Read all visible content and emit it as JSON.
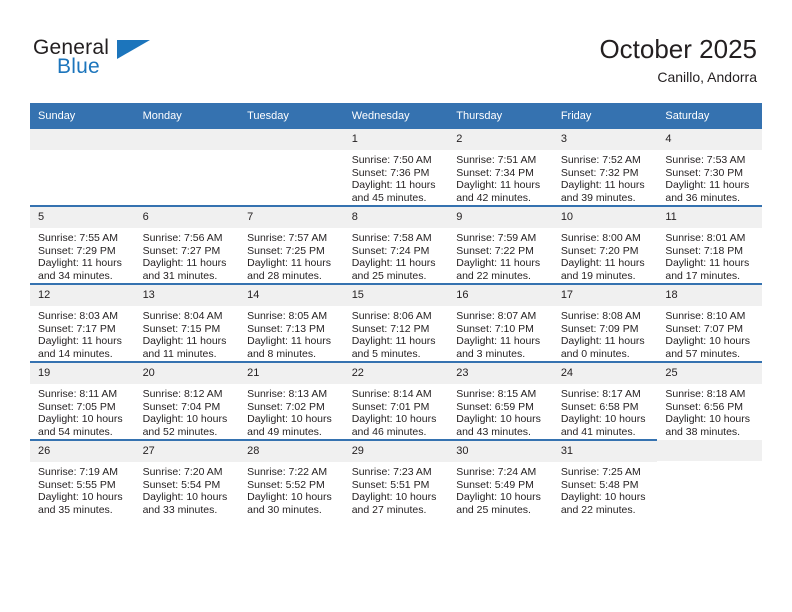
{
  "logo": {
    "word1": "General",
    "word2": "Blue",
    "triangle_color": "#1c75bc",
    "icon": "general-blue-logo"
  },
  "header": {
    "title": "October 2025",
    "location": "Canillo, Andorra",
    "header_bg": "#3572b0"
  },
  "weekdays": [
    "Sunday",
    "Monday",
    "Tuesday",
    "Wednesday",
    "Thursday",
    "Friday",
    "Saturday"
  ],
  "labels": {
    "sunrise": "Sunrise:",
    "sunset": "Sunset:",
    "daylight": "Daylight:"
  },
  "weeks": [
    [
      {
        "day": "",
        "empty": true
      },
      {
        "day": "",
        "empty": true
      },
      {
        "day": "",
        "empty": true
      },
      {
        "day": "1",
        "sunrise": "Sunrise: 7:50 AM",
        "sunset": "Sunset: 7:36 PM",
        "daylight": "Daylight: 11 hours and 45 minutes."
      },
      {
        "day": "2",
        "sunrise": "Sunrise: 7:51 AM",
        "sunset": "Sunset: 7:34 PM",
        "daylight": "Daylight: 11 hours and 42 minutes."
      },
      {
        "day": "3",
        "sunrise": "Sunrise: 7:52 AM",
        "sunset": "Sunset: 7:32 PM",
        "daylight": "Daylight: 11 hours and 39 minutes."
      },
      {
        "day": "4",
        "sunrise": "Sunrise: 7:53 AM",
        "sunset": "Sunset: 7:30 PM",
        "daylight": "Daylight: 11 hours and 36 minutes."
      }
    ],
    [
      {
        "day": "5",
        "sunrise": "Sunrise: 7:55 AM",
        "sunset": "Sunset: 7:29 PM",
        "daylight": "Daylight: 11 hours and 34 minutes."
      },
      {
        "day": "6",
        "sunrise": "Sunrise: 7:56 AM",
        "sunset": "Sunset: 7:27 PM",
        "daylight": "Daylight: 11 hours and 31 minutes."
      },
      {
        "day": "7",
        "sunrise": "Sunrise: 7:57 AM",
        "sunset": "Sunset: 7:25 PM",
        "daylight": "Daylight: 11 hours and 28 minutes."
      },
      {
        "day": "8",
        "sunrise": "Sunrise: 7:58 AM",
        "sunset": "Sunset: 7:24 PM",
        "daylight": "Daylight: 11 hours and 25 minutes."
      },
      {
        "day": "9",
        "sunrise": "Sunrise: 7:59 AM",
        "sunset": "Sunset: 7:22 PM",
        "daylight": "Daylight: 11 hours and 22 minutes."
      },
      {
        "day": "10",
        "sunrise": "Sunrise: 8:00 AM",
        "sunset": "Sunset: 7:20 PM",
        "daylight": "Daylight: 11 hours and 19 minutes."
      },
      {
        "day": "11",
        "sunrise": "Sunrise: 8:01 AM",
        "sunset": "Sunset: 7:18 PM",
        "daylight": "Daylight: 11 hours and 17 minutes."
      }
    ],
    [
      {
        "day": "12",
        "sunrise": "Sunrise: 8:03 AM",
        "sunset": "Sunset: 7:17 PM",
        "daylight": "Daylight: 11 hours and 14 minutes."
      },
      {
        "day": "13",
        "sunrise": "Sunrise: 8:04 AM",
        "sunset": "Sunset: 7:15 PM",
        "daylight": "Daylight: 11 hours and 11 minutes."
      },
      {
        "day": "14",
        "sunrise": "Sunrise: 8:05 AM",
        "sunset": "Sunset: 7:13 PM",
        "daylight": "Daylight: 11 hours and 8 minutes."
      },
      {
        "day": "15",
        "sunrise": "Sunrise: 8:06 AM",
        "sunset": "Sunset: 7:12 PM",
        "daylight": "Daylight: 11 hours and 5 minutes."
      },
      {
        "day": "16",
        "sunrise": "Sunrise: 8:07 AM",
        "sunset": "Sunset: 7:10 PM",
        "daylight": "Daylight: 11 hours and 3 minutes."
      },
      {
        "day": "17",
        "sunrise": "Sunrise: 8:08 AM",
        "sunset": "Sunset: 7:09 PM",
        "daylight": "Daylight: 11 hours and 0 minutes."
      },
      {
        "day": "18",
        "sunrise": "Sunrise: 8:10 AM",
        "sunset": "Sunset: 7:07 PM",
        "daylight": "Daylight: 10 hours and 57 minutes."
      }
    ],
    [
      {
        "day": "19",
        "sunrise": "Sunrise: 8:11 AM",
        "sunset": "Sunset: 7:05 PM",
        "daylight": "Daylight: 10 hours and 54 minutes."
      },
      {
        "day": "20",
        "sunrise": "Sunrise: 8:12 AM",
        "sunset": "Sunset: 7:04 PM",
        "daylight": "Daylight: 10 hours and 52 minutes."
      },
      {
        "day": "21",
        "sunrise": "Sunrise: 8:13 AM",
        "sunset": "Sunset: 7:02 PM",
        "daylight": "Daylight: 10 hours and 49 minutes."
      },
      {
        "day": "22",
        "sunrise": "Sunrise: 8:14 AM",
        "sunset": "Sunset: 7:01 PM",
        "daylight": "Daylight: 10 hours and 46 minutes."
      },
      {
        "day": "23",
        "sunrise": "Sunrise: 8:15 AM",
        "sunset": "Sunset: 6:59 PM",
        "daylight": "Daylight: 10 hours and 43 minutes."
      },
      {
        "day": "24",
        "sunrise": "Sunrise: 8:17 AM",
        "sunset": "Sunset: 6:58 PM",
        "daylight": "Daylight: 10 hours and 41 minutes."
      },
      {
        "day": "25",
        "sunrise": "Sunrise: 8:18 AM",
        "sunset": "Sunset: 6:56 PM",
        "daylight": "Daylight: 10 hours and 38 minutes."
      }
    ],
    [
      {
        "day": "26",
        "sunrise": "Sunrise: 7:19 AM",
        "sunset": "Sunset: 5:55 PM",
        "daylight": "Daylight: 10 hours and 35 minutes."
      },
      {
        "day": "27",
        "sunrise": "Sunrise: 7:20 AM",
        "sunset": "Sunset: 5:54 PM",
        "daylight": "Daylight: 10 hours and 33 minutes."
      },
      {
        "day": "28",
        "sunrise": "Sunrise: 7:22 AM",
        "sunset": "Sunset: 5:52 PM",
        "daylight": "Daylight: 10 hours and 30 minutes."
      },
      {
        "day": "29",
        "sunrise": "Sunrise: 7:23 AM",
        "sunset": "Sunset: 5:51 PM",
        "daylight": "Daylight: 10 hours and 27 minutes."
      },
      {
        "day": "30",
        "sunrise": "Sunrise: 7:24 AM",
        "sunset": "Sunset: 5:49 PM",
        "daylight": "Daylight: 10 hours and 25 minutes."
      },
      {
        "day": "31",
        "sunrise": "Sunrise: 7:25 AM",
        "sunset": "Sunset: 5:48 PM",
        "daylight": "Daylight: 10 hours and 22 minutes."
      },
      {
        "day": "",
        "empty": true
      }
    ]
  ]
}
